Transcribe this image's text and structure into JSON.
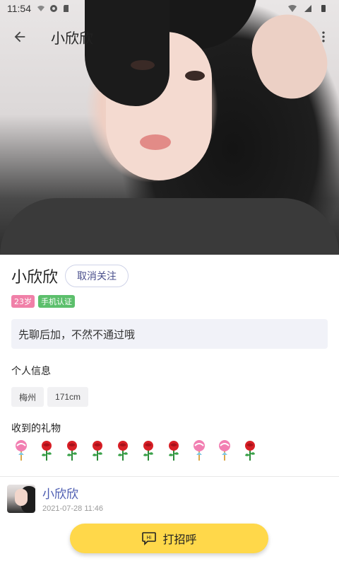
{
  "status_bar": {
    "time": "11:54"
  },
  "toolbar": {
    "title": "小欣欣"
  },
  "profile": {
    "name": "小欣欣",
    "unfollow_label": "取消关注",
    "badges": {
      "age": "23岁",
      "verify": "手机认证"
    },
    "bio": "先聊后加，不然不通过哦"
  },
  "personal_info": {
    "title": "个人信息",
    "tags": [
      "梅州",
      "171cm"
    ]
  },
  "gifts": {
    "title": "收到的礼物",
    "items": [
      "lollipop-icon",
      "rose-icon",
      "rose-icon",
      "rose-icon",
      "rose-icon",
      "rose-icon",
      "rose-icon",
      "lollipop-icon",
      "lollipop-icon",
      "rose-icon"
    ]
  },
  "post": {
    "author": "小欣欣",
    "time": "2021-07-28 11:46"
  },
  "greet_button": {
    "label": "打招呼"
  },
  "colors": {
    "accent": "#ffd84a",
    "age_badge": "#f080a8",
    "verify_badge": "#5cbf6c",
    "link": "#4a5ab0"
  }
}
